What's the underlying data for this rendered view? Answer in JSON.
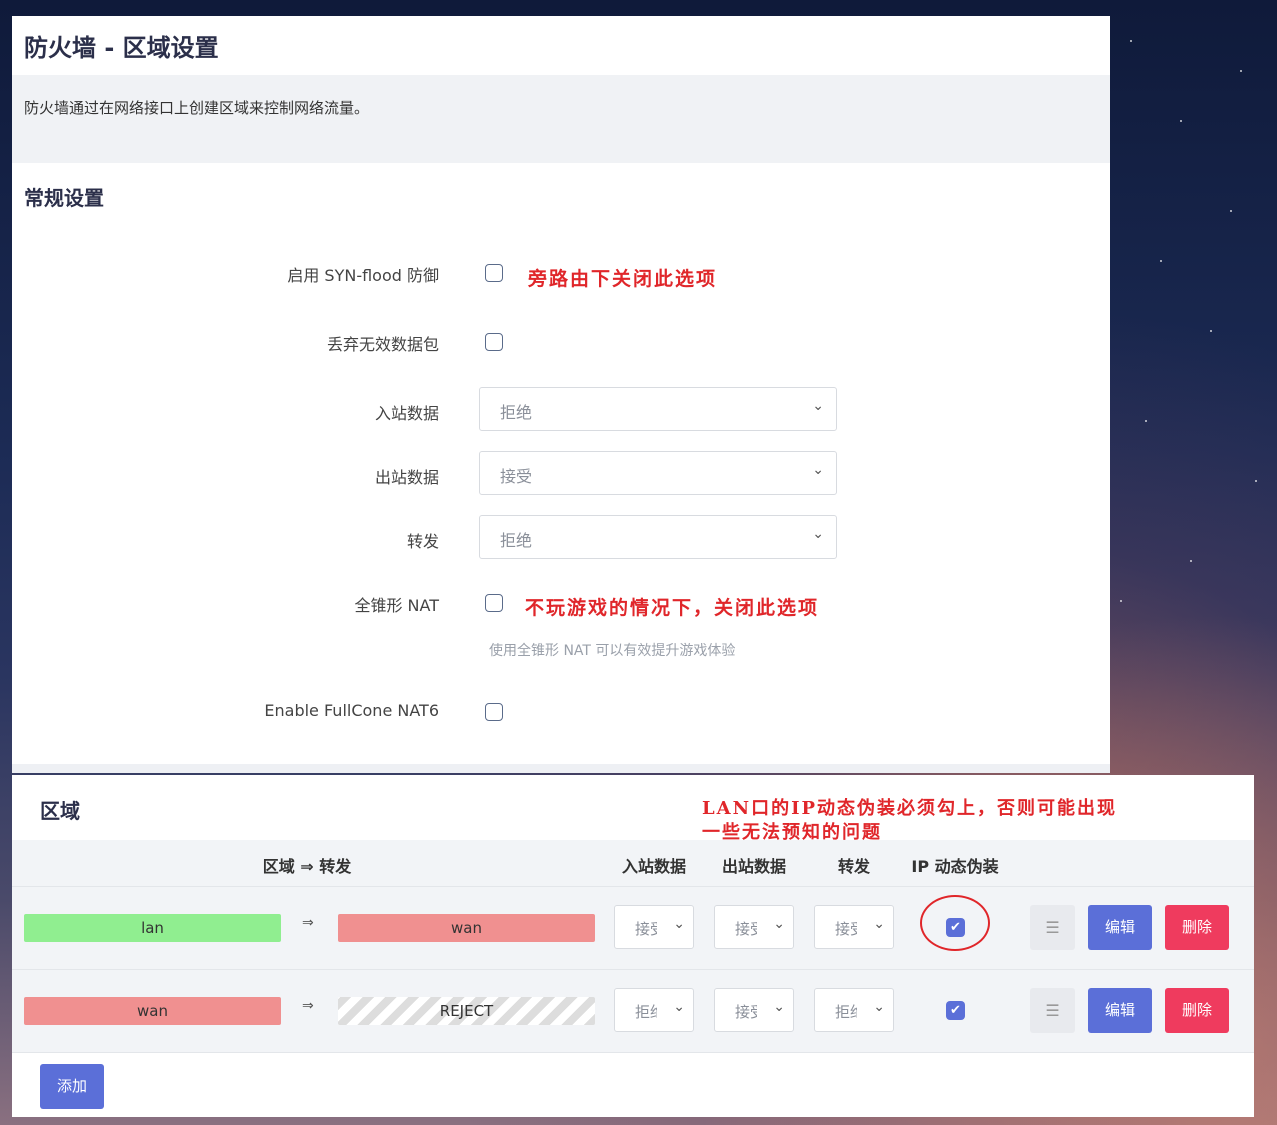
{
  "page": {
    "title": "防火墙 - 区域设置",
    "description": "防火墙通过在网络接口上创建区域来控制网络流量。"
  },
  "general": {
    "section_title": "常规设置",
    "syn_flood_label": "启用 SYN-flood 防御",
    "syn_flood_checked": false,
    "drop_invalid_label": "丢弃无效数据包",
    "drop_invalid_checked": false,
    "input_label": "入站数据",
    "input_value": "拒绝",
    "output_label": "出站数据",
    "output_value": "接受",
    "forward_label": "转发",
    "forward_value": "拒绝",
    "fullcone_label": "全锥形 NAT",
    "fullcone_checked": false,
    "fullcone_help": "使用全锥形 NAT 可以有效提升游戏体验",
    "fullcone6_label": "Enable FullCone NAT6",
    "fullcone6_checked": false
  },
  "annotations": {
    "syn_note": "旁路由下关闭此选项",
    "fullcone_note": "不玩游戏的情况下，关闭此选项",
    "masq_note_line1": "LAN口的IP动态伪装必须勾上，否则可能出现",
    "masq_note_line2": "一些无法预知的问题",
    "color": "#e0262a"
  },
  "zones": {
    "title": "区域",
    "headers": {
      "zone_forward": "区域 ⇒ 转发",
      "input": "入站数据",
      "output": "出站数据",
      "forward": "转发",
      "masq": "IP 动态伪装"
    },
    "rows": [
      {
        "zone": "lan",
        "zone_color": "#90ee90",
        "arrow": "⇒",
        "dest": "wan",
        "dest_color": "#f09090",
        "input": "接受",
        "output": "接受",
        "forward": "接受",
        "masq_checked": true,
        "check": "✔",
        "handle": "☰",
        "edit": "编辑",
        "delete": "删除"
      },
      {
        "zone": "wan",
        "zone_color": "#f09090",
        "arrow": "⇒",
        "dest": "REJECT",
        "dest_color": "striped",
        "input": "拒绝",
        "output": "接受",
        "forward": "拒绝",
        "masq_checked": true,
        "check": "✔",
        "handle": "☰",
        "edit": "编辑",
        "delete": "删除"
      }
    ],
    "add_label": "添加"
  },
  "colors": {
    "primary": "#5b6fd8",
    "danger": "#ef3b5e"
  }
}
